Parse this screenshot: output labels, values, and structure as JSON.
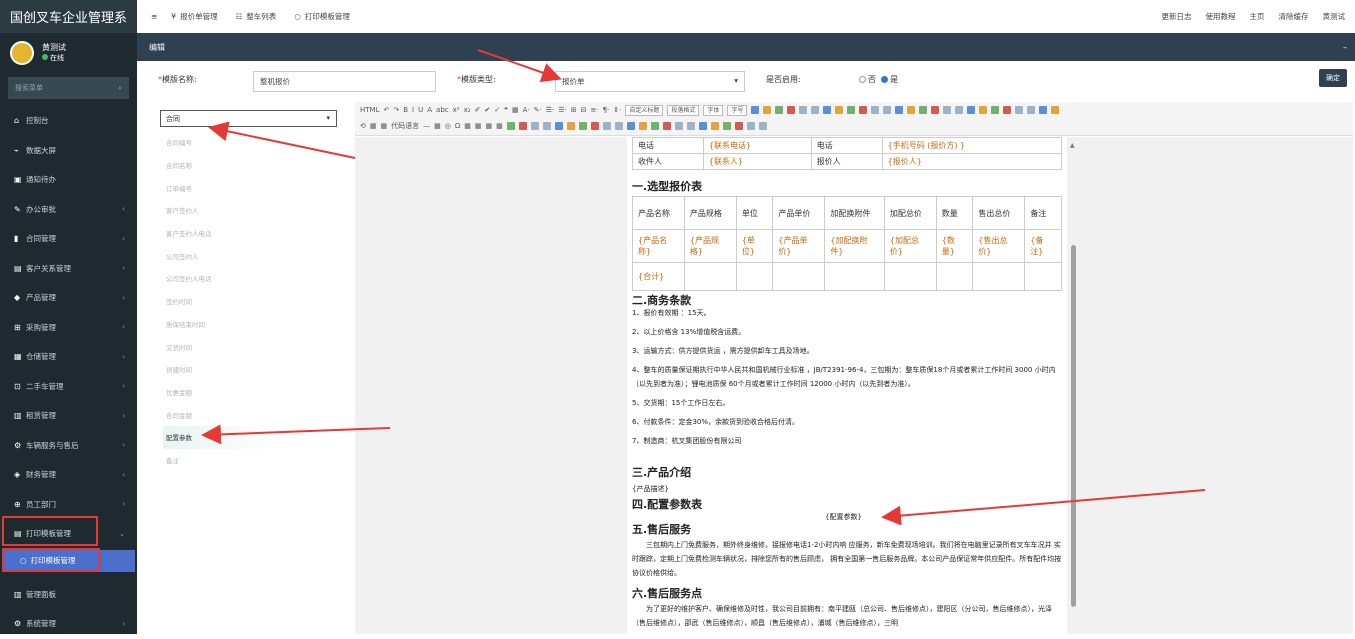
{
  "app": {
    "title": "国创叉车企业管理系",
    "user_name": "黄测试",
    "status": "在线",
    "search_placeholder": "搜索菜单"
  },
  "top_tabs": [
    {
      "icon": "¥",
      "label": "报价单管理"
    },
    {
      "icon": "☷",
      "label": "整车列表"
    },
    {
      "icon": "○",
      "label": "打印模板管理"
    }
  ],
  "top_right": [
    "更新日志",
    "使用教程",
    "主页",
    "清除缓存",
    "黄测试"
  ],
  "menu": [
    {
      "icon": "⌂",
      "label": "控制台",
      "chev": false
    },
    {
      "icon": "⌁",
      "label": "数据大屏",
      "chev": false
    },
    {
      "icon": "▣",
      "label": "通知待办",
      "chev": false
    },
    {
      "icon": "✎",
      "label": "办公审批",
      "chev": true
    },
    {
      "icon": "▮",
      "label": "合同管理",
      "chev": true
    },
    {
      "icon": "▤",
      "label": "客户关系管理",
      "chev": true
    },
    {
      "icon": "◆",
      "label": "产品管理",
      "chev": true
    },
    {
      "icon": "⊞",
      "label": "采购管理",
      "chev": true
    },
    {
      "icon": "▦",
      "label": "仓储管理",
      "chev": true
    },
    {
      "icon": "⊡",
      "label": "二手车管理",
      "chev": true
    },
    {
      "icon": "▥",
      "label": "租赁管理",
      "chev": true
    },
    {
      "icon": "⚙",
      "label": "车辆服务与售后",
      "chev": true
    },
    {
      "icon": "◈",
      "label": "财务管理",
      "chev": true
    },
    {
      "icon": "⊕",
      "label": "员工部门",
      "chev": true
    },
    {
      "icon": "▤",
      "label": "打印模板管理",
      "chev": "down"
    }
  ],
  "submenu": {
    "icon": "○",
    "label": "打印模板管理"
  },
  "menu_after": [
    {
      "icon": "▥",
      "label": "管理面板",
      "chev": false
    },
    {
      "icon": "⚙",
      "label": "系统管理",
      "chev": true
    }
  ],
  "panel": {
    "title": "编辑",
    "minimize": "–"
  },
  "form": {
    "name_label": "模版名称:",
    "name_value": "整机报价",
    "type_label": "模版类型:",
    "type_value": "报价单",
    "enable_label": "是否启用:",
    "opt_no": "否",
    "opt_yes": "是",
    "confirm": "确定"
  },
  "field_select": "合同",
  "fields": [
    "合同编号",
    "合同名称",
    "订单编号",
    "客户签约人",
    "客户签约人电话",
    "公司签约人",
    "公司签约人电话",
    "签约时间",
    "质保结束时间",
    "交货时间",
    "创建时间",
    "优惠金额",
    "合同金额",
    "配置参数",
    "备注"
  ],
  "toolbar": {
    "row1": [
      "HTML",
      "↶",
      "↷",
      "B",
      "I",
      "U",
      "A",
      "abc",
      "x²",
      "x₂",
      "✐",
      "✔",
      "✓",
      "❝",
      "▦",
      "A·",
      "✎·",
      "☰·",
      "☰·",
      "⊞",
      "⊟",
      "≡·",
      "¶·",
      "⇕·"
    ],
    "heading_sel": "自定义标题",
    "para_sel": "段落格式",
    "font_sel": "字体",
    "size_sel": "字号",
    "row2": [
      "⟲",
      "▦",
      "▦",
      "代码语言",
      "—",
      "▦",
      "◎",
      "Ω",
      "▦",
      "▦",
      "▦",
      "▦"
    ]
  },
  "doc": {
    "contact_rows": [
      [
        "电话",
        "{联系电话}",
        "电话",
        "{手机号码 (报价方) }"
      ],
      [
        "收件人",
        "{联系人}",
        "报价人",
        "{报价人}"
      ]
    ],
    "h1": "一.选型报价表",
    "table_head": [
      "产品名称",
      "产品规格",
      "单位",
      "产品单价",
      "加配换附件",
      "加配总价",
      "数量",
      "售出总价",
      "备注"
    ],
    "table_row": [
      "{产品名称}",
      "{产品规格}",
      "{单位}",
      "{产品单价}",
      "{加配换附件}",
      "{加配总价}",
      "{数量}",
      "{售出总价}",
      "{备注}"
    ],
    "total": "{合计}",
    "h2": "二.商务条款",
    "terms": [
      "1、报价有效期 ：15天。",
      "2、以上价格含 13%增值税含运费。",
      "3、运输方式：供方提供货运 ，需方提供卸车工具及场地。",
      "4、整车的质量保证期执行中华人民共和国机械行业标准 ，JB/T2391-96-4，三包期为：整车质保18个月或者累计工作时间 3000 小时内（以先到者为准）；锂电池质保 60个月或者累计工作时间 12000 小时内（以先到者为准）。",
      "5、交货期：15个工作日左右。",
      "6、付款条件：定金30%，余款货到验收合格后付清。",
      "7、制造商：杭叉集团股份有限公司"
    ],
    "h3": "三.产品介绍",
    "product_desc": "{产品描述}",
    "h4": "四.配置参数表",
    "config": "{配置参数}",
    "h5": "五.售后服务",
    "service": "三包期内上门免费服务，期外终身维修，接报修电话1-2小时内响 应服务，新车免费现场培训。我们将在电脑里记录所有叉车车况并 实时跟踪，定期上门免费检测车辆状况，排除您所有的售后顾虑， 拥有全国第一售后服务品牌。本公司产品保证常年供应配件。所有配件均按协议价格供给。",
    "h6": "六.售后服务点",
    "points": "为了更好的维护客户、确保维修及时性，我公司目前拥有：南平建瓯（总公司、售后维修点），建阳区（分公司，售后维修点），光泽（售后维修点），邵武（售后维修点），顺昌（售后维修点），浦城（售后维修点），三明"
  },
  "colors": {
    "sidebar": "#1f2a30",
    "header": "#2f4050",
    "active_menu": "#4b6fcb",
    "arrow": "#e53935",
    "placeholder": "#c96a0c"
  }
}
